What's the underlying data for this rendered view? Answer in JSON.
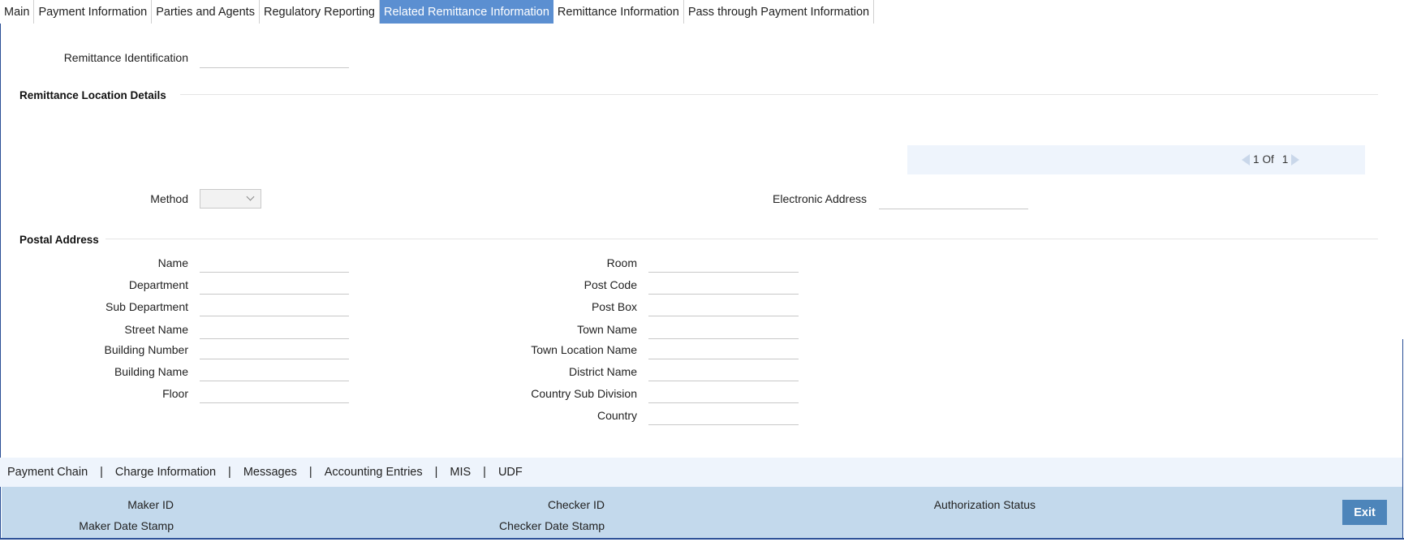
{
  "tabs": [
    {
      "label": "Main",
      "active": false
    },
    {
      "label": "Payment Information",
      "active": false
    },
    {
      "label": "Parties and Agents",
      "active": false
    },
    {
      "label": "Regulatory Reporting",
      "active": false
    },
    {
      "label": "Related Remittance Information",
      "active": true
    },
    {
      "label": "Remittance Information",
      "active": false
    },
    {
      "label": "Pass through Payment Information",
      "active": false
    }
  ],
  "remittance": {
    "identification_label": "Remittance Identification",
    "identification_value": ""
  },
  "location": {
    "title": "Remittance Location Details",
    "pager": {
      "current": "1",
      "of_label": "Of",
      "total": "1"
    },
    "method_label": "Method",
    "method_value": "",
    "electronic_address_label": "Electronic Address",
    "electronic_address_value": ""
  },
  "postal": {
    "title": "Postal Address",
    "left_fields": [
      {
        "label": "Name",
        "value": ""
      },
      {
        "label": "Department",
        "value": ""
      },
      {
        "label": "Sub Department",
        "value": ""
      },
      {
        "label": "Street Name",
        "value": ""
      },
      {
        "label": "Building Number",
        "value": ""
      },
      {
        "label": "Building Name",
        "value": ""
      },
      {
        "label": "Floor",
        "value": ""
      }
    ],
    "right_fields": [
      {
        "label": "Room",
        "value": ""
      },
      {
        "label": "Post Code",
        "value": ""
      },
      {
        "label": "Post Box",
        "value": ""
      },
      {
        "label": "Town Name",
        "value": ""
      },
      {
        "label": "Town Location Name",
        "value": ""
      },
      {
        "label": "District Name",
        "value": ""
      },
      {
        "label": "Country Sub Division",
        "value": ""
      },
      {
        "label": "Country",
        "value": ""
      }
    ]
  },
  "bottom_links": [
    "Payment Chain",
    "Charge Information",
    "Messages",
    "Accounting Entries",
    "MIS",
    "UDF"
  ],
  "bottom_separator": "|",
  "audit": {
    "maker_id": "Maker ID",
    "maker_date_stamp": "Maker Date Stamp",
    "checker_id": "Checker ID",
    "checker_date_stamp": "Checker Date Stamp",
    "authorization_status": "Authorization Status"
  },
  "exit_label": "Exit",
  "colors": {
    "accent": "#5b8fd1",
    "frame": "#2a4f96",
    "status_bar": "#c3d9ec",
    "exit_button": "#4d85ba"
  }
}
